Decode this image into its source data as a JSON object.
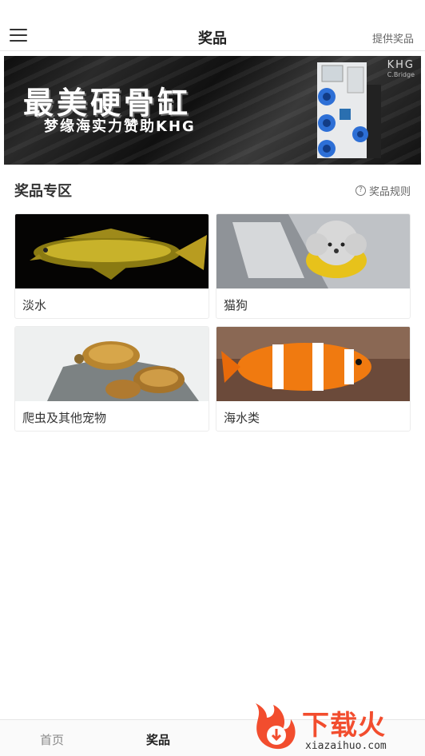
{
  "header": {
    "title": "奖品",
    "provide_link": "提供奖品"
  },
  "banner": {
    "title": "最美硬骨缸",
    "subtitle": "梦缘海实力赞助KHG",
    "logo": "KHG",
    "logo_sub": "C.Bridge"
  },
  "section": {
    "title": "奖品专区",
    "rules_link": "奖品规则"
  },
  "categories": [
    {
      "label": "淡水",
      "image": "arowana"
    },
    {
      "label": "猫狗",
      "image": "poodle"
    },
    {
      "label": "爬虫及其他宠物",
      "image": "tortoises"
    },
    {
      "label": "海水类",
      "image": "clownfish"
    }
  ],
  "bottom_nav": {
    "home": "首页",
    "prize": "奖品"
  },
  "watermark": {
    "text": "下载火",
    "url": "xiazaihuo.com"
  },
  "colors": {
    "accent": "#f24d2e",
    "active_nav": "#222222",
    "inactive_nav": "#888888"
  }
}
